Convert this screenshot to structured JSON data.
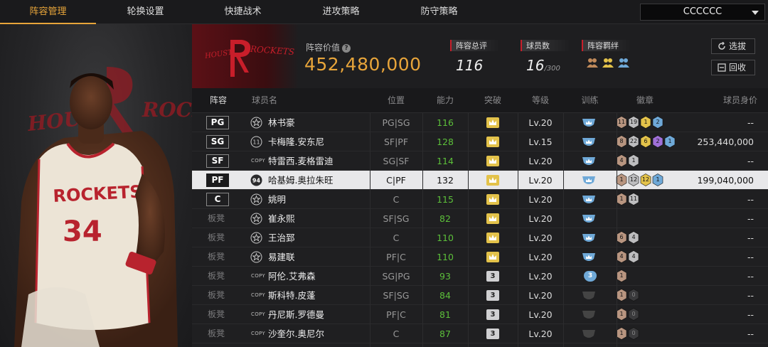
{
  "nav": {
    "tabs": [
      {
        "label": "阵容管理",
        "active": true
      },
      {
        "label": "轮换设置",
        "active": false
      },
      {
        "label": "快捷战术",
        "active": false
      },
      {
        "label": "进攻策略",
        "active": false
      },
      {
        "label": "防守策略",
        "active": false
      }
    ],
    "team_select": "CCCCCC"
  },
  "left_panel": {
    "jersey_team": "ROCKETS",
    "jersey_number": "34",
    "banner_text_l": "HOUS",
    "banner_text_r": "ROCK"
  },
  "header": {
    "logo_left": "HOUSTON",
    "logo_right": "ROCKETS",
    "value_label": "阵容价值",
    "value": "452,480,000",
    "overall_label": "阵容总评",
    "overall_value": "116",
    "players_label": "球员数",
    "players_value": "16",
    "players_max": "/300",
    "bond_label": "阵容羁绊",
    "pick_button": "选拔",
    "recycle_button": "回收",
    "colors": {
      "accent": "#e8a53a",
      "red": "#c81e2a"
    }
  },
  "table": {
    "headers": [
      "阵容",
      "球员名",
      "位置",
      "能力",
      "突破",
      "等级",
      "训练",
      "徽章",
      "球员身价"
    ],
    "rows": [
      {
        "slot": "PG",
        "starter": true,
        "icon": "star",
        "name": "林书豪",
        "pos": "PG|SG",
        "ability": "116",
        "green": true,
        "breakthrough": "crown",
        "level": "Lv.20",
        "training": "crown",
        "badges": [
          {
            "t": "11",
            "c": "#b89580"
          },
          {
            "t": "19",
            "c": "#bdbdbf"
          },
          {
            "t": "1",
            "c": "#e3c24a"
          },
          {
            "t": "2",
            "c": "#6fa9d8"
          }
        ],
        "price": "--"
      },
      {
        "slot": "SG",
        "starter": true,
        "icon": "ring",
        "icon_text": "11",
        "name": "卡梅隆.安东尼",
        "pos": "SF|PF",
        "ability": "128",
        "green": true,
        "breakthrough": "crown",
        "level": "Lv.15",
        "training": "crown",
        "badges": [
          {
            "t": "8",
            "c": "#b89580"
          },
          {
            "t": "22",
            "c": "#bdbdbf"
          },
          {
            "t": "6",
            "c": "#e3c24a"
          },
          {
            "t": "2",
            "c": "#a070d8"
          },
          {
            "t": "1",
            "c": "#6fa9d8"
          }
        ],
        "price": "253,440,000"
      },
      {
        "slot": "SF",
        "starter": true,
        "icon": "copy",
        "name": "特雷西.麦格雷迪",
        "pos": "SG|SF",
        "ability": "114",
        "green": true,
        "breakthrough": "crown",
        "level": "Lv.20",
        "training": "crown",
        "badges": [
          {
            "t": "4",
            "c": "#b89580"
          },
          {
            "t": "1",
            "c": "#bdbdbf"
          }
        ],
        "price": "--"
      },
      {
        "slot": "PF",
        "starter": true,
        "selected": true,
        "icon": "badge",
        "icon_text": "94",
        "name": "哈基姆.奥拉朱旺",
        "pos": "C|PF",
        "ability": "132",
        "green": false,
        "breakthrough": "crown",
        "level": "Lv.20",
        "training": "crown",
        "badges": [
          {
            "t": "1",
            "c": "#b89580"
          },
          {
            "t": "12",
            "c": "#bdbdbf"
          },
          {
            "t": "12",
            "c": "#e3c24a"
          },
          {
            "t": "1",
            "c": "#6fa9d8"
          }
        ],
        "price": "199,040,000"
      },
      {
        "slot": "C",
        "starter": true,
        "icon": "star",
        "name": "姚明",
        "pos": "C",
        "ability": "115",
        "green": true,
        "breakthrough": "crown",
        "level": "Lv.20",
        "training": "crown",
        "badges": [
          {
            "t": "1",
            "c": "#b89580"
          },
          {
            "t": "11",
            "c": "#bdbdbf"
          }
        ],
        "price": "--"
      },
      {
        "slot": "板凳",
        "starter": false,
        "icon": "star",
        "name": "崔永熙",
        "pos": "SF|SG",
        "ability": "82",
        "green": true,
        "breakthrough": "crown",
        "level": "Lv.20",
        "training": "crown",
        "badges": [],
        "price": "--"
      },
      {
        "slot": "板凳",
        "starter": false,
        "icon": "star",
        "name": "王治郅",
        "pos": "C",
        "ability": "110",
        "green": true,
        "breakthrough": "crown",
        "level": "Lv.20",
        "training": "crown",
        "badges": [
          {
            "t": "6",
            "c": "#b89580"
          },
          {
            "t": "4",
            "c": "#bdbdbf"
          }
        ],
        "price": "--"
      },
      {
        "slot": "板凳",
        "starter": false,
        "icon": "star",
        "name": "易建联",
        "pos": "PF|C",
        "ability": "110",
        "green": true,
        "breakthrough": "crown",
        "level": "Lv.20",
        "training": "crown",
        "badges": [
          {
            "t": "4",
            "c": "#b89580"
          },
          {
            "t": "4",
            "c": "#bdbdbf"
          }
        ],
        "price": "--"
      },
      {
        "slot": "板凳",
        "starter": false,
        "icon": "copy",
        "name": "阿伦.艾弗森",
        "pos": "SG|PG",
        "ability": "93",
        "green": true,
        "breakthrough": "3",
        "level": "Lv.20",
        "training": "3",
        "badges": [
          {
            "t": "1",
            "c": "#b89580"
          }
        ],
        "price": "--"
      },
      {
        "slot": "板凳",
        "starter": false,
        "icon": "copy",
        "name": "斯科特.皮蓬",
        "pos": "SF|SG",
        "ability": "84",
        "green": true,
        "breakthrough": "3",
        "level": "Lv.20",
        "training": "grey",
        "badges": [
          {
            "t": "1",
            "c": "#b89580"
          },
          {
            "t": "0",
            "c": "#3a3a3c"
          }
        ],
        "price": "--"
      },
      {
        "slot": "板凳",
        "starter": false,
        "icon": "copy",
        "name": "丹尼斯.罗德曼",
        "pos": "PF|C",
        "ability": "81",
        "green": true,
        "breakthrough": "3",
        "level": "Lv.20",
        "training": "grey",
        "badges": [
          {
            "t": "1",
            "c": "#b89580"
          },
          {
            "t": "0",
            "c": "#3a3a3c"
          }
        ],
        "price": "--"
      },
      {
        "slot": "板凳",
        "starter": false,
        "icon": "copy",
        "name": "沙奎尔.奥尼尔",
        "pos": "C",
        "ability": "87",
        "green": true,
        "breakthrough": "3",
        "level": "Lv.20",
        "training": "grey",
        "badges": [
          {
            "t": "1",
            "c": "#b89580"
          },
          {
            "t": "0",
            "c": "#3a3a3c"
          }
        ],
        "price": "--"
      }
    ]
  }
}
